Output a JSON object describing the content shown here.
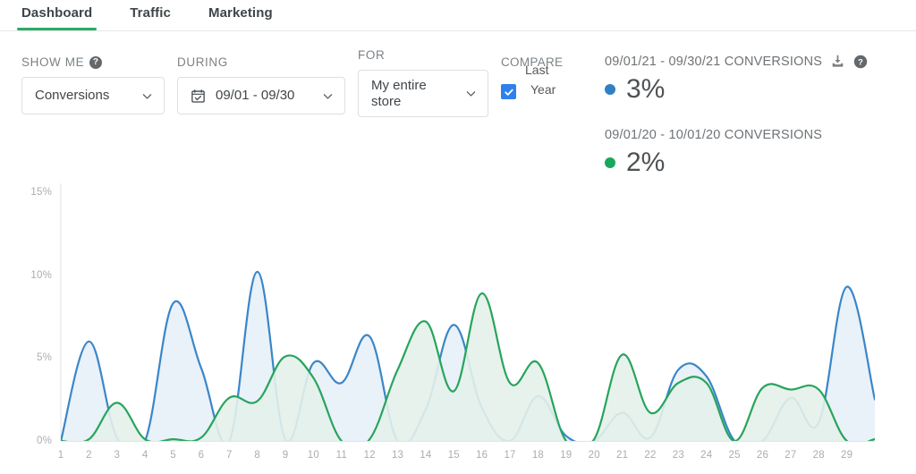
{
  "tabs": [
    {
      "label": "Dashboard",
      "active": true
    },
    {
      "label": "Traffic",
      "active": false
    },
    {
      "label": "Marketing",
      "active": false
    }
  ],
  "controls": {
    "show_me": {
      "label": "SHOW ME",
      "value": "Conversions",
      "help_glyph": "?"
    },
    "during": {
      "label": "DURING",
      "value": "09/01 - 09/30"
    },
    "for": {
      "label": "FOR",
      "value": "My entire store"
    },
    "compare": {
      "label": "COMPARE",
      "option_line1": "Last",
      "option_line2": "Year",
      "checked": true
    }
  },
  "legend": {
    "primary": {
      "range_label": "09/01/21 - 09/30/21 CONVERSIONS",
      "value": "3%",
      "color": "#2f80c4"
    },
    "secondary": {
      "range_label": "09/01/20 - 10/01/20 CONVERSIONS",
      "value": "2%",
      "color": "#17a85c"
    },
    "download_icon": "download-icon",
    "help_icon": "help-icon",
    "help_glyph": "?"
  },
  "colors": {
    "accent_green": "#2eaa63",
    "series_blue_line": "#3a86c8",
    "series_blue_fill": "#e7eff8",
    "series_green_line": "#27a45c",
    "series_green_fill": "#e4f1ea",
    "checkbox_blue": "#2f80ed",
    "axis": "#e1e4e6",
    "tick_text": "#a9aeb2"
  },
  "chart_data": {
    "type": "area",
    "title": "",
    "xlabel": "",
    "ylabel": "",
    "ylim": [
      0,
      15
    ],
    "yticks": [
      0,
      5,
      10,
      15
    ],
    "ytick_labels": [
      "0%",
      "5%",
      "10%",
      "15%"
    ],
    "grid": false,
    "legend_position": "top-right",
    "x": [
      1,
      2,
      3,
      4,
      5,
      6,
      7,
      8,
      9,
      10,
      11,
      12,
      13,
      14,
      15,
      16,
      17,
      18,
      19,
      20,
      21,
      22,
      23,
      24,
      25,
      26,
      27,
      28,
      29
    ],
    "categories": [
      "1",
      "2",
      "3",
      "4",
      "5",
      "6",
      "7",
      "8",
      "9",
      "10",
      "11",
      "12",
      "13",
      "14",
      "15",
      "16",
      "17",
      "18",
      "19",
      "20",
      "21",
      "22",
      "23",
      "24",
      "25",
      "26",
      "27",
      "28",
      "29"
    ],
    "series": [
      {
        "name": "09/01/21 - 09/30/21 CONVERSIONS",
        "color": "#3a86c8",
        "fill": "#e7eff8",
        "values": [
          0,
          6.0,
          0.2,
          0,
          8.3,
          4.4,
          0,
          10.2,
          0.1,
          4.7,
          3.5,
          6.3,
          0,
          1.9,
          7.0,
          2.0,
          0,
          2.7,
          0.3,
          0,
          1.7,
          0.2,
          4.3,
          3.9,
          0,
          0,
          2.6,
          1.1,
          9.3,
          2.5
        ]
      },
      {
        "name": "09/01/20 - 10/01/20 CONVERSIONS",
        "color": "#27a45c",
        "fill": "#e4f1ea",
        "values": [
          0,
          0.1,
          2.3,
          0.1,
          0.1,
          0.2,
          2.6,
          2.4,
          5.1,
          3.8,
          0,
          0.1,
          4.3,
          7.2,
          3.0,
          8.9,
          3.5,
          4.7,
          0,
          0.1,
          5.2,
          1.7,
          3.5,
          3.5,
          0,
          3.2,
          3.1,
          3.1,
          0,
          0.1
        ]
      }
    ]
  }
}
